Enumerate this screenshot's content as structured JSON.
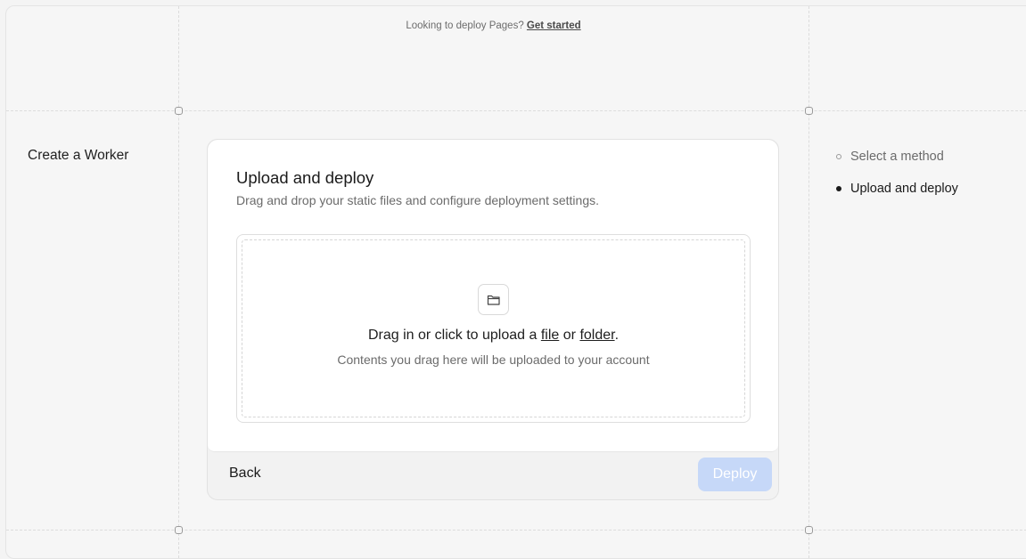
{
  "banner": {
    "text": "Looking to deploy Pages?",
    "link": "Get started"
  },
  "section": {
    "title": "Create a Worker"
  },
  "card": {
    "title": "Upload and deploy",
    "subtitle": "Drag and drop your static files and configure deployment settings.",
    "dropzone": {
      "icon": "folder-icon",
      "text_prefix": "Drag in or click to upload a",
      "file_link": "file",
      "text_middle": "or",
      "folder_link": "folder",
      "text_suffix": ".",
      "subtext": "Contents you drag here will be uploaded to your account"
    },
    "back_label": "Back",
    "deploy_label": "Deploy"
  },
  "steps": [
    {
      "label": "Select a method",
      "state": "complete"
    },
    {
      "label": "Upload and deploy",
      "state": "current"
    }
  ],
  "colors": {
    "deploy_disabled": "#c6d8f8",
    "background": "#f6f6f6"
  }
}
